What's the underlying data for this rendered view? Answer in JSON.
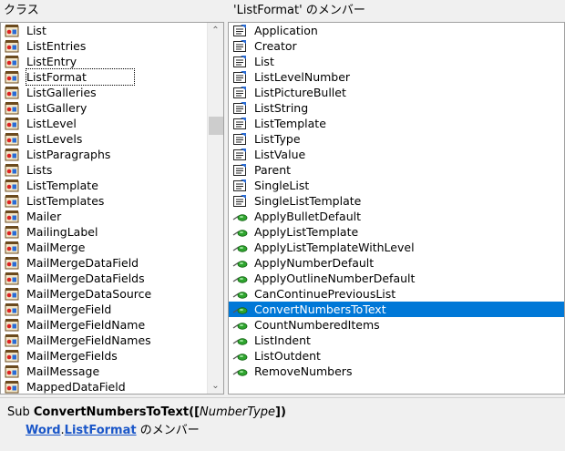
{
  "classes_pane": {
    "header": "クラス",
    "items": [
      "List",
      "ListEntries",
      "ListEntry",
      "ListFormat",
      "ListGalleries",
      "ListGallery",
      "ListLevel",
      "ListLevels",
      "ListParagraphs",
      "Lists",
      "ListTemplate",
      "ListTemplates",
      "Mailer",
      "MailingLabel",
      "MailMerge",
      "MailMergeDataField",
      "MailMergeDataFields",
      "MailMergeDataSource",
      "MailMergeField",
      "MailMergeFieldName",
      "MailMergeFieldNames",
      "MailMergeFields",
      "MailMessage",
      "MappedDataField"
    ],
    "focused_item": "ListFormat",
    "icon": "class-icon"
  },
  "members_pane": {
    "header": "'ListFormat' のメンバー",
    "items": [
      {
        "label": "Application",
        "kind": "property"
      },
      {
        "label": "Creator",
        "kind": "property"
      },
      {
        "label": "List",
        "kind": "property"
      },
      {
        "label": "ListLevelNumber",
        "kind": "property"
      },
      {
        "label": "ListPictureBullet",
        "kind": "property"
      },
      {
        "label": "ListString",
        "kind": "property"
      },
      {
        "label": "ListTemplate",
        "kind": "property"
      },
      {
        "label": "ListType",
        "kind": "property"
      },
      {
        "label": "ListValue",
        "kind": "property"
      },
      {
        "label": "Parent",
        "kind": "property"
      },
      {
        "label": "SingleList",
        "kind": "property"
      },
      {
        "label": "SingleListTemplate",
        "kind": "property"
      },
      {
        "label": "ApplyBulletDefault",
        "kind": "method"
      },
      {
        "label": "ApplyListTemplate",
        "kind": "method"
      },
      {
        "label": "ApplyListTemplateWithLevel",
        "kind": "method"
      },
      {
        "label": "ApplyNumberDefault",
        "kind": "method"
      },
      {
        "label": "ApplyOutlineNumberDefault",
        "kind": "method"
      },
      {
        "label": "CanContinuePreviousList",
        "kind": "method"
      },
      {
        "label": "ConvertNumbersToText",
        "kind": "method"
      },
      {
        "label": "CountNumberedItems",
        "kind": "method"
      },
      {
        "label": "ListIndent",
        "kind": "method"
      },
      {
        "label": "ListOutdent",
        "kind": "method"
      },
      {
        "label": "RemoveNumbers",
        "kind": "method"
      }
    ],
    "selected_item": "ConvertNumbersToText",
    "selection_color": "#0078d7"
  },
  "details": {
    "keyword": "Sub",
    "name": "ConvertNumbersToText",
    "open": "([",
    "param": "NumberType",
    "close": "])",
    "library_link": "Word",
    "dot": ".",
    "class_link": "ListFormat",
    "member_of": " のメンバー"
  },
  "scroll": {
    "up_icon": "▲",
    "down_icon": "▼"
  }
}
